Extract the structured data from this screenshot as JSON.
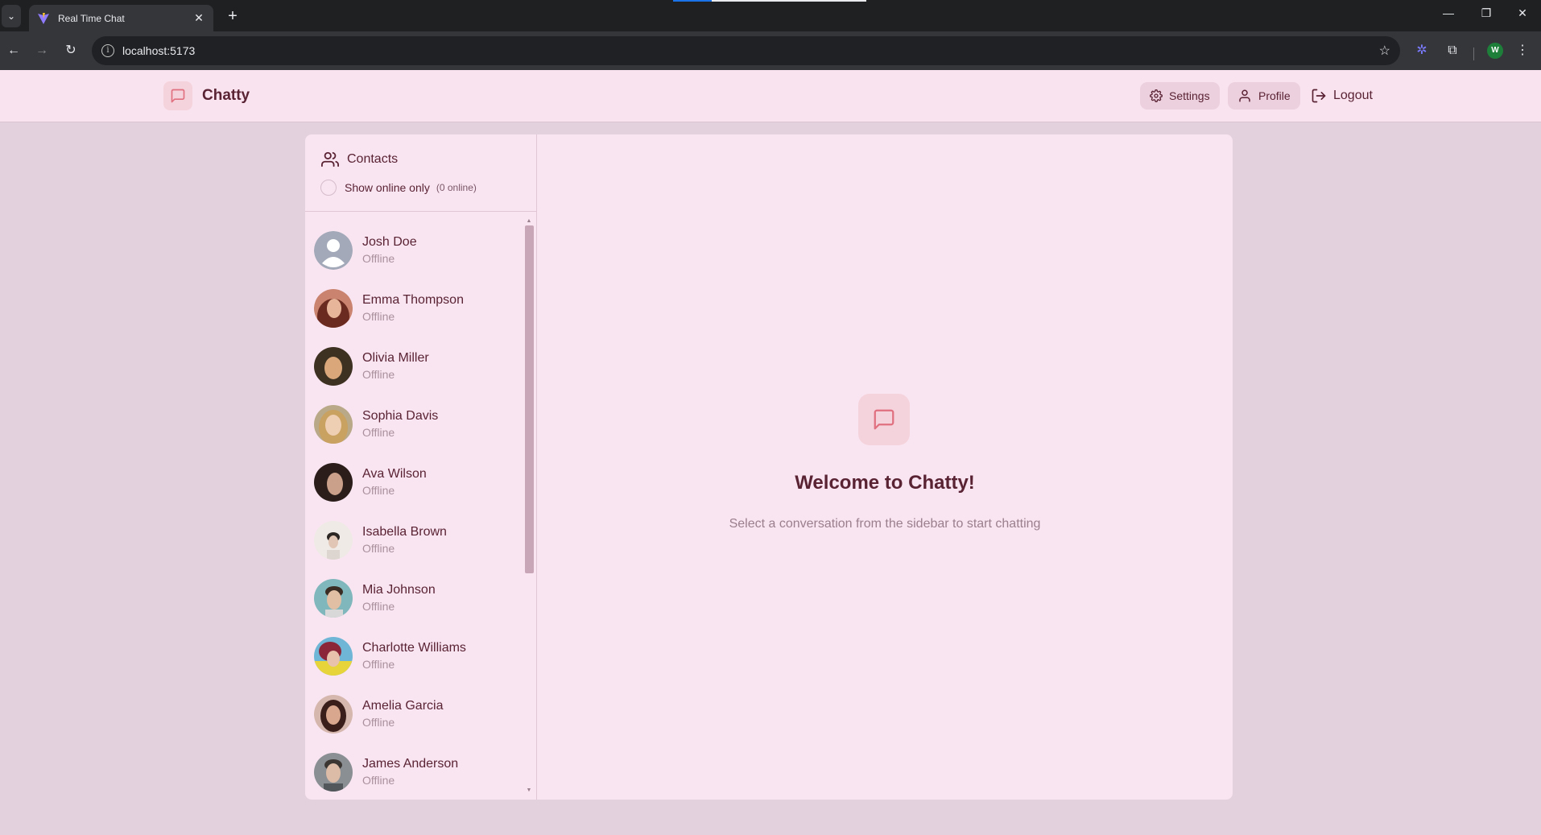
{
  "browser": {
    "tab_title": "Real Time Chat",
    "url": "localhost:5173",
    "profile_initial": "W"
  },
  "header": {
    "brand": "Chatty",
    "settings_label": "Settings",
    "profile_label": "Profile",
    "logout_label": "Logout"
  },
  "sidebar": {
    "title": "Contacts",
    "online_filter_label": "Show online only",
    "online_count": "(0 online)",
    "contacts": [
      {
        "name": "Josh Doe",
        "status": "Offline",
        "avatar": "placeholder"
      },
      {
        "name": "Emma Thompson",
        "status": "Offline",
        "avatar": "photo"
      },
      {
        "name": "Olivia Miller",
        "status": "Offline",
        "avatar": "photo"
      },
      {
        "name": "Sophia Davis",
        "status": "Offline",
        "avatar": "photo"
      },
      {
        "name": "Ava Wilson",
        "status": "Offline",
        "avatar": "photo"
      },
      {
        "name": "Isabella Brown",
        "status": "Offline",
        "avatar": "photo"
      },
      {
        "name": "Mia Johnson",
        "status": "Offline",
        "avatar": "photo"
      },
      {
        "name": "Charlotte Williams",
        "status": "Offline",
        "avatar": "photo"
      },
      {
        "name": "Amelia Garcia",
        "status": "Offline",
        "avatar": "photo"
      },
      {
        "name": "James Anderson",
        "status": "Offline",
        "avatar": "photo"
      }
    ]
  },
  "welcome": {
    "title": "Welcome to Chatty!",
    "subtitle": "Select a conversation from the sidebar to start chatting"
  },
  "colors": {
    "accent": "#5a2334",
    "header_bg": "#f9e3ef",
    "page_bg": "#e3d2de",
    "card_bg": "#f9e5f1",
    "icon_tint": "#e0707f"
  }
}
